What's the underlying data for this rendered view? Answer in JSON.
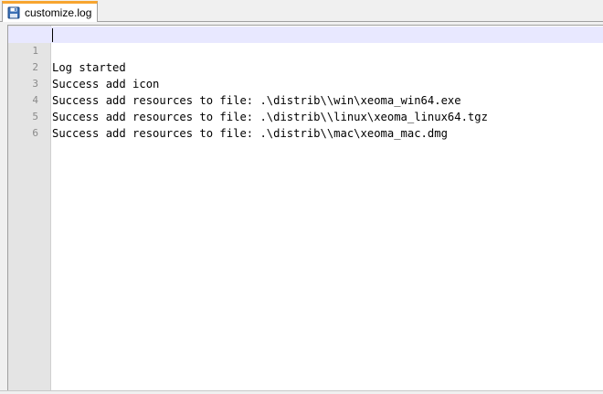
{
  "tab": {
    "label": "customize.log",
    "icon": "save-disk-icon",
    "accent": "#f7a530"
  },
  "editor": {
    "current_line": 1,
    "lines": [
      {
        "num": "1",
        "text": "Log started"
      },
      {
        "num": "2",
        "text": "Success add icon"
      },
      {
        "num": "3",
        "text": "Success add resources to file: .\\distrib\\\\win\\xeoma_win64.exe"
      },
      {
        "num": "4",
        "text": "Success add resources to file: .\\distrib\\\\linux\\xeoma_linux64.tgz"
      },
      {
        "num": "5",
        "text": "Success add resources to file: .\\distrib\\\\mac\\xeoma_mac.dmg"
      },
      {
        "num": "6",
        "text": ""
      }
    ]
  }
}
